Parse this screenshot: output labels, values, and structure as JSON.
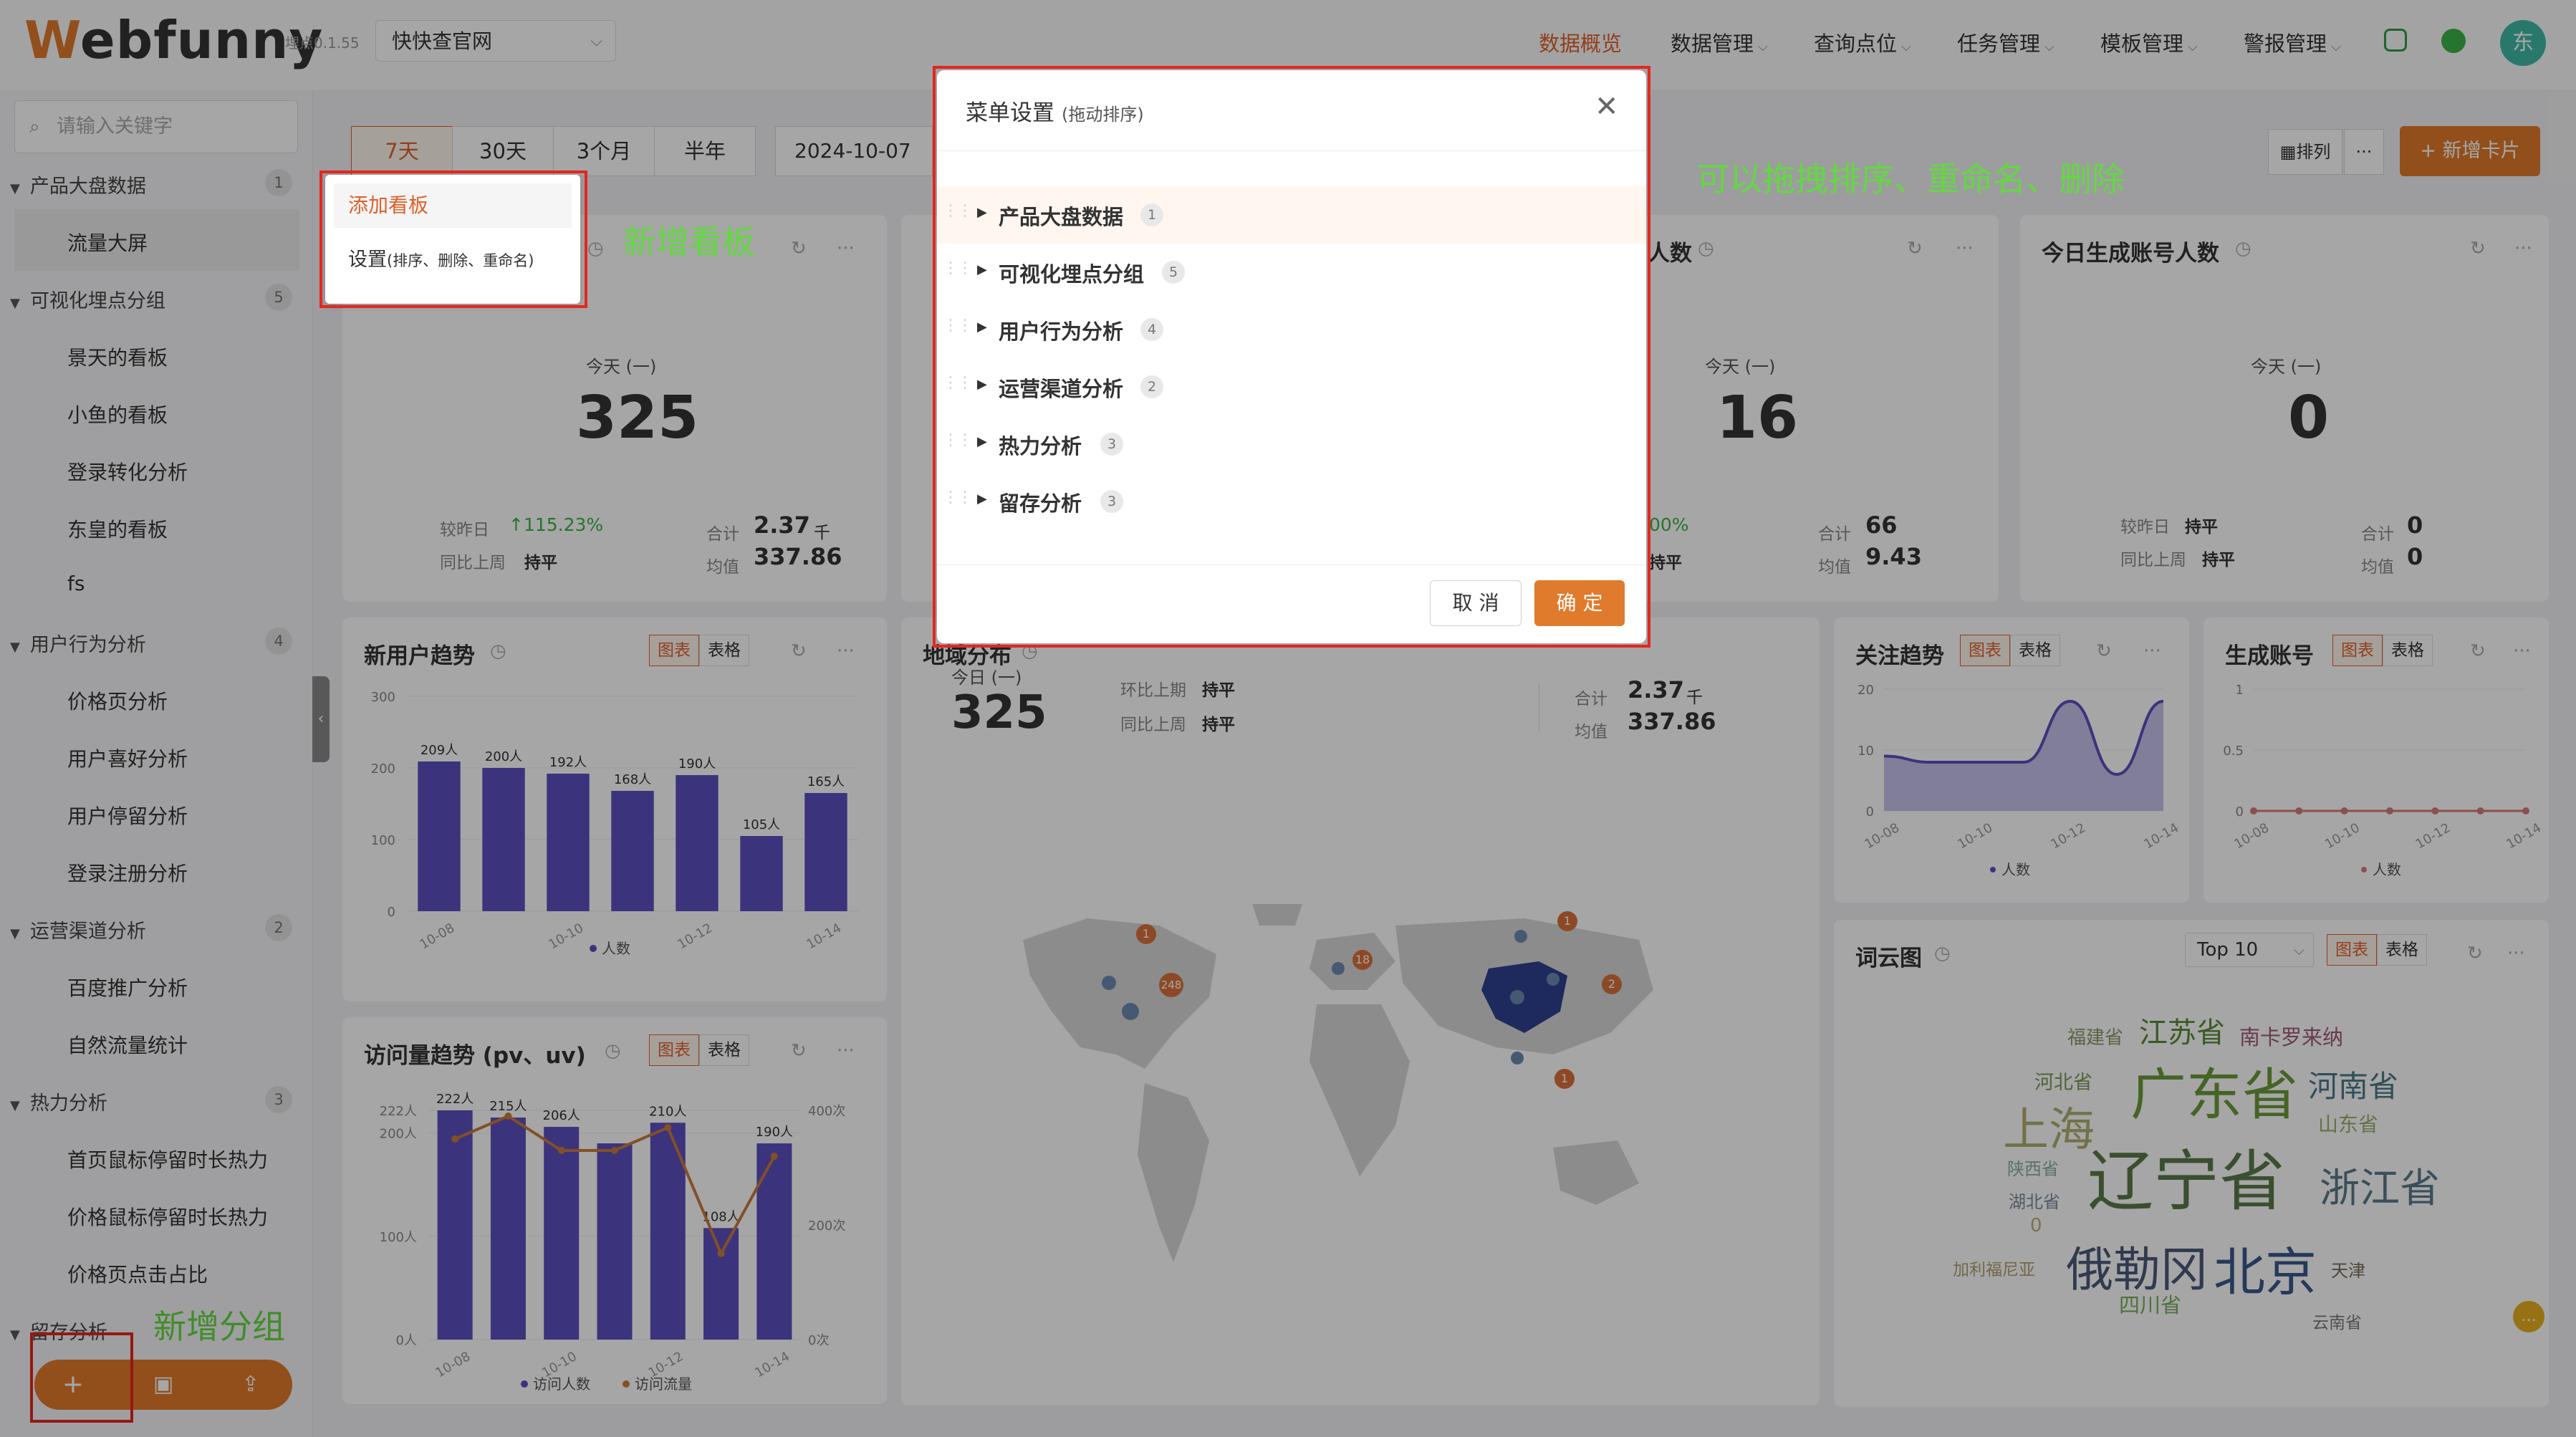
{
  "header": {
    "logo": "Webfunny",
    "version": "埋点0.1.55",
    "site": "快快查官网",
    "nav": [
      "数据概览",
      "数据管理",
      "查询点位",
      "任务管理",
      "模板管理",
      "警报管理"
    ],
    "avatar": "东"
  },
  "sidebar": {
    "search_placeholder": "请输入关键字",
    "groups": [
      {
        "label": "产品大盘数据",
        "count": "1",
        "items": [
          "流量大屏"
        ]
      },
      {
        "label": "可视化埋点分组",
        "count": "5",
        "items": [
          "景天的看板",
          "小鱼的看板",
          "登录转化分析",
          "东皇的看板",
          "fs"
        ]
      },
      {
        "label": "用户行为分析",
        "count": "4",
        "items": [
          "价格页分析",
          "用户喜好分析",
          "用户停留分析",
          "登录注册分析"
        ]
      },
      {
        "label": "运营渠道分析",
        "count": "2",
        "items": [
          "百度推广分析",
          "自然流量统计"
        ]
      },
      {
        "label": "热力分析",
        "count": "3",
        "items": [
          "首页鼠标停留时长热力",
          "价格鼠标停留时长热力",
          "价格页点击占比"
        ]
      },
      {
        "label": "留存分析",
        "count": "",
        "items": []
      }
    ],
    "bottom_icons": [
      "plus-icon",
      "save-icon",
      "share-icon"
    ]
  },
  "annotations": {
    "new_board": "新增看板",
    "new_group": "新增分组",
    "drag_tip": "可以拖拽排序、重命名、删除"
  },
  "popup": {
    "add": "添加看板",
    "settings": "设置",
    "settings_note": "(排序、删除、重命名)"
  },
  "toolbar": {
    "tabs": [
      "7天",
      "30天",
      "3个月",
      "半年"
    ],
    "date": "2024-10-07",
    "arrange": "排列",
    "more": "···",
    "add_card": "+ 新增卡片"
  },
  "cards": {
    "c1": {
      "today": "今天 (一)",
      "value": "325",
      "l1": "较昨日",
      "v1": "↑115.23%",
      "l2": "同比上周",
      "v2": "持平",
      "l3": "合计",
      "v3": "2.37",
      "u3": "千",
      "l4": "均值",
      "v4": "337.86"
    },
    "c3": {
      "title_tail": "人数",
      "today": "今天 (一)",
      "value": "16",
      "pct": "00%",
      "flat": "持平",
      "l3": "合计",
      "v3": "66",
      "l4": "均值",
      "v4": "9.43"
    },
    "c4": {
      "title": "今日生成账号人数",
      "today": "今天 (一)",
      "value": "0",
      "l1": "较昨日",
      "v1": "持平",
      "l2": "同比上周",
      "v2": "持平",
      "l3": "合计",
      "v3": "0",
      "l4": "均值",
      "v4": "0"
    },
    "region": {
      "title": "地域分布",
      "today": "今日 (一)",
      "value": "325",
      "l1": "环比上期",
      "v1": "持平",
      "l2": "同比上周",
      "v2": "持平",
      "l3": "合计",
      "v3": "2.37",
      "u3": "千",
      "l4": "均值",
      "v4": "337.86",
      "top": "Top 10"
    },
    "wordcloud": {
      "title": "词云图",
      "top": "Top 10"
    },
    "seg_chart": "图表",
    "seg_table": "表格"
  },
  "map_markers": [
    "1",
    "248",
    "18",
    "1",
    "2",
    "1"
  ],
  "wordcloud_words": [
    {
      "t": "福建省",
      "c": "#8a9a6a"
    },
    {
      "t": "江苏省",
      "c": "#5a8a3a"
    },
    {
      "t": "南卡罗来纳",
      "c": "#a05a7a"
    },
    {
      "t": "河北省",
      "c": "#7a9a5a"
    },
    {
      "t": "广东省",
      "c": "#6a9a3a"
    },
    {
      "t": "河南省",
      "c": "#4a7a8a"
    },
    {
      "t": "上海",
      "c": "#b0b070"
    },
    {
      "t": "山东省",
      "c": "#9ab070"
    },
    {
      "t": "陕西省",
      "c": "#8ab0a0"
    },
    {
      "t": "辽宁省",
      "c": "#5a7a4a"
    },
    {
      "t": "浙江省",
      "c": "#5a7a8a"
    },
    {
      "t": "湖北省",
      "c": "#7a8a9a"
    },
    {
      "t": "0",
      "c": "#c0b070"
    },
    {
      "t": "加利福尼亚",
      "c": "#b0a070"
    },
    {
      "t": "俄勒冈",
      "c": "#4a5a7a"
    },
    {
      "t": "北京",
      "c": "#3a5a8a"
    },
    {
      "t": "天津",
      "c": "#7a6a5a"
    },
    {
      "t": "四川省",
      "c": "#7ab060"
    },
    {
      "t": "云南省",
      "c": "#7a7a7a"
    }
  ],
  "chart_data": [
    {
      "type": "bar",
      "title": "新用户趋势",
      "categories": [
        "10-08",
        "10-09",
        "10-10",
        "10-11",
        "10-12",
        "10-13",
        "10-14"
      ],
      "x_tick_labels": [
        "10-08",
        "10-10",
        "10-12",
        "10-14"
      ],
      "series": [
        {
          "name": "人数",
          "values": [
            209,
            200,
            192,
            168,
            190,
            105,
            165
          ],
          "labels": [
            "209人",
            "200人",
            "192人",
            "168人",
            "190人",
            "105人",
            "165人"
          ]
        }
      ],
      "ylim": [
        0,
        300
      ],
      "yticks": [
        "0",
        "100",
        "200",
        "300"
      ]
    },
    {
      "type": "bar",
      "title": "访问量趋势 (pv、uv)",
      "categories": [
        "10-08",
        "10-09",
        "10-10",
        "10-11",
        "10-12",
        "10-13",
        "10-14"
      ],
      "x_tick_labels": [
        "10-08",
        "10-10",
        "10-12",
        "10-14"
      ],
      "series": [
        {
          "name": "访问人数",
          "values": [
            222,
            215,
            206,
            190,
            210,
            108,
            190
          ],
          "labels": [
            "222人",
            "215人",
            "206人",
            "",
            "210人",
            "108人",
            "190人"
          ]
        },
        {
          "name": "访问流量",
          "values": [
            350,
            390,
            330,
            330,
            370,
            150,
            320
          ],
          "labels": [
            "",
            "",
            "",
            "",
            "",
            "",
            ""
          ]
        }
      ],
      "ylim_left": [
        0,
        222
      ],
      "yticks_left": [
        "0人",
        "100人",
        "200人",
        "222人"
      ],
      "ylim_right": [
        0,
        400
      ],
      "yticks_right": [
        "0次",
        "200次",
        "400次"
      ]
    },
    {
      "type": "area",
      "title": "关注趋势",
      "categories": [
        "10-08",
        "10-09",
        "10-10",
        "10-11",
        "10-12",
        "10-13",
        "10-14"
      ],
      "x_tick_labels": [
        "10-08",
        "10-10",
        "10-12",
        "10-14"
      ],
      "series": [
        {
          "name": "人数",
          "values": [
            9,
            8,
            8,
            8,
            18,
            6,
            18
          ]
        }
      ],
      "ylim": [
        0,
        20
      ],
      "yticks": [
        "0",
        "10",
        "20"
      ]
    },
    {
      "type": "line",
      "title": "生成账号",
      "categories": [
        "10-08",
        "10-09",
        "10-10",
        "10-11",
        "10-12",
        "10-13",
        "10-14"
      ],
      "x_tick_labels": [
        "10-08",
        "10-10",
        "10-12",
        "10-14"
      ],
      "series": [
        {
          "name": "人数",
          "values": [
            0,
            0,
            0,
            0,
            0,
            0,
            0
          ]
        }
      ],
      "ylim": [
        0,
        1
      ],
      "yticks": [
        "0",
        "0.5",
        "1"
      ]
    }
  ],
  "modal": {
    "title": "菜单设置",
    "subtitle": "(拖动排序)",
    "rows": [
      {
        "label": "产品大盘数据",
        "count": "1"
      },
      {
        "label": "可视化埋点分组",
        "count": "5"
      },
      {
        "label": "用户行为分析",
        "count": "4"
      },
      {
        "label": "运营渠道分析",
        "count": "2"
      },
      {
        "label": "热力分析",
        "count": "3"
      },
      {
        "label": "留存分析",
        "count": "3"
      }
    ],
    "cancel": "取 消",
    "ok": "确 定"
  },
  "colors": {
    "accent": "#e07a2c",
    "bar": "#5c4fc0",
    "line": "#c97a3a",
    "annotation": "#62d940",
    "highlight_box": "#e5261e"
  }
}
